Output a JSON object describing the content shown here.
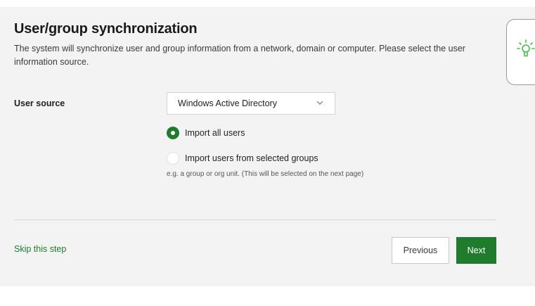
{
  "wizard": {
    "title": "User/group synchronization",
    "description": "The system will synchronize user and group information from a network, domain or computer. Please select the user information source."
  },
  "form": {
    "user_source_label": "User source",
    "user_source_selected": "Windows Active Directory",
    "import_options": [
      {
        "label": "Import all users",
        "checked": true
      },
      {
        "label": "Import users from selected groups",
        "checked": false
      }
    ],
    "import_hint": "e.g. a group or org unit. (This will be selected on the next page)"
  },
  "footer": {
    "skip_label": "Skip this step",
    "previous_label": "Previous",
    "next_label": "Next"
  },
  "icons": {
    "tips": "lightbulb-icon",
    "dropdown": "chevron-down-icon"
  },
  "colors": {
    "accent": "#1e7c2c",
    "panel_background": "#f3f3f3",
    "tip_bulb": "#3cc23c"
  }
}
